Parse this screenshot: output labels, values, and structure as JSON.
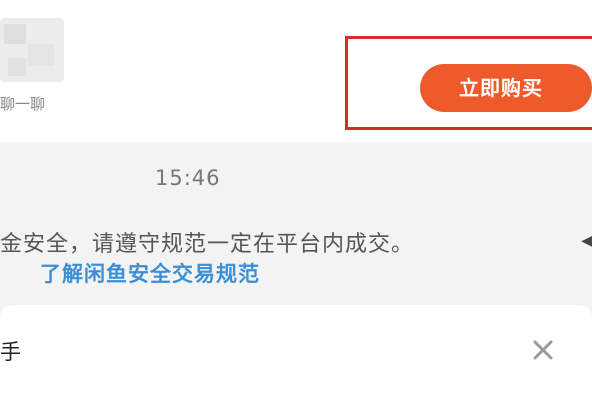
{
  "header": {
    "chat_label": "聊一聊",
    "buy_button_label": "立即购买",
    "highlight_color": "#d92b2b",
    "buy_button_color": "#ee5a2b"
  },
  "messages": {
    "timestamp": "15:46",
    "safety_notice": "金安全，请遵守规范一定在平台内成交。",
    "safety_link": "了解闲鱼安全交易规范",
    "link_color": "#3c8fd6"
  },
  "bottom_panel": {
    "title": "手",
    "close_icon": "close-icon"
  }
}
